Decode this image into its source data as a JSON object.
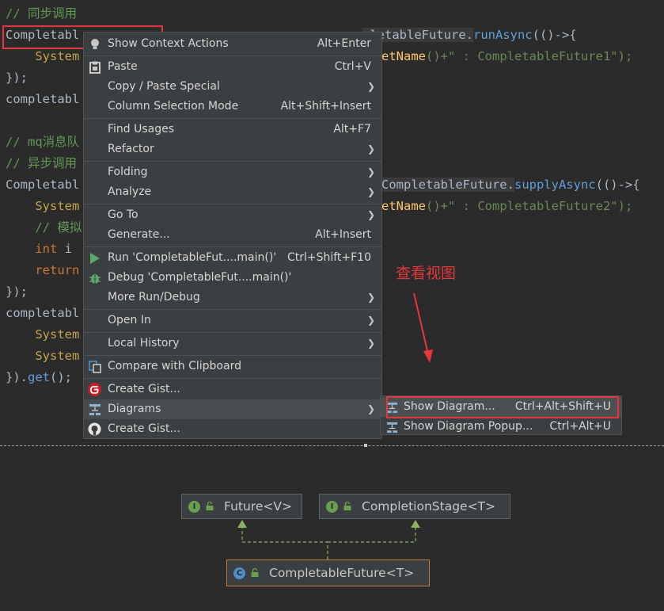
{
  "editor": {
    "lines": [
      {
        "comment": "// 同步调用"
      },
      {
        "left": "Completabl",
        "right_cls": "pletableFuture.",
        "right_mth": "runAsync",
        "right_tail": "(()->{"
      },
      {
        "indent": "    ",
        "left": "System",
        "right_fn": "etName",
        "right_tail": "()+\" : CompletableFuture1\");"
      },
      {
        "left": "});"
      },
      {
        "left": "completabl"
      },
      {
        "left": ""
      },
      {
        "comment": "// mq消息队"
      },
      {
        "comment": "// 异步调用"
      },
      {
        "left": "Completabl",
        "right_cls": "CompletableFuture.",
        "right_mth": "supplyAsync",
        "right_tail": "(()->{"
      },
      {
        "indent": "    ",
        "left": "System",
        "right_fn": "etName",
        "right_tail": "()+\" : CompletableFuture2\");"
      },
      {
        "indent": "    ",
        "comment": "// 模拟"
      },
      {
        "indent": "    ",
        "kw": "int",
        "left": " i"
      },
      {
        "indent": "    ",
        "kw": "return"
      },
      {
        "left": "});"
      },
      {
        "left": "completabl"
      },
      {
        "indent": "    ",
        "left": "System"
      },
      {
        "indent": "    ",
        "left": "System"
      },
      {
        "left": "}).",
        "mth": "get",
        "tail": "();"
      }
    ]
  },
  "context_menu": {
    "items": [
      {
        "label": "Show Context Actions",
        "shortcut": "Alt+Enter",
        "icon": "bulb-icon"
      },
      {
        "label": "Paste",
        "shortcut": "Ctrl+V",
        "icon": "clipboard-icon"
      },
      {
        "label": "Copy / Paste Special",
        "submenu": true
      },
      {
        "label": "Column Selection Mode",
        "shortcut": "Alt+Shift+Insert"
      },
      {
        "label": "Find Usages",
        "shortcut": "Alt+F7"
      },
      {
        "label": "Refactor",
        "submenu": true
      },
      {
        "label": "Folding",
        "submenu": true
      },
      {
        "label": "Analyze",
        "submenu": true
      },
      {
        "label": "Go To",
        "submenu": true
      },
      {
        "label": "Generate...",
        "shortcut": "Alt+Insert"
      },
      {
        "label": "Run 'CompletableFut....main()'",
        "shortcut": "Ctrl+Shift+F10",
        "icon": "run-icon"
      },
      {
        "label": "Debug 'CompletableFut....main()'",
        "icon": "debug-icon"
      },
      {
        "label": "More Run/Debug",
        "submenu": true
      },
      {
        "label": "Open In",
        "submenu": true
      },
      {
        "label": "Local History",
        "submenu": true
      },
      {
        "label": "Compare with Clipboard",
        "icon": "compare-icon"
      },
      {
        "label": "Create Gist...",
        "icon": "gitee-icon"
      },
      {
        "label": "Diagrams",
        "submenu": true,
        "icon": "diagram-icon",
        "active": true
      },
      {
        "label": "Create Gist...",
        "icon": "github-icon"
      }
    ]
  },
  "diagrams_submenu": {
    "items": [
      {
        "label": "Show Diagram...",
        "shortcut": "Ctrl+Alt+Shift+U",
        "icon": "diagram-icon"
      },
      {
        "label": "Show Diagram Popup...",
        "shortcut": "Ctrl+Alt+U",
        "icon": "diagram-icon"
      }
    ]
  },
  "annotation": {
    "text": "查看视图"
  },
  "diagram": {
    "nodes": [
      {
        "name": "Future<V>",
        "badge": "I",
        "badge_color": "#6a9e52"
      },
      {
        "name": "CompletionStage<T>",
        "badge": "I",
        "badge_color": "#6a9e52"
      },
      {
        "name": "CompletableFuture<T>",
        "badge": "C",
        "badge_color": "#4e8fc9",
        "border_color": "#c07a3c"
      }
    ]
  },
  "colors": {
    "accent_red": "#e5373b",
    "arrow_green": "#8ab060"
  }
}
